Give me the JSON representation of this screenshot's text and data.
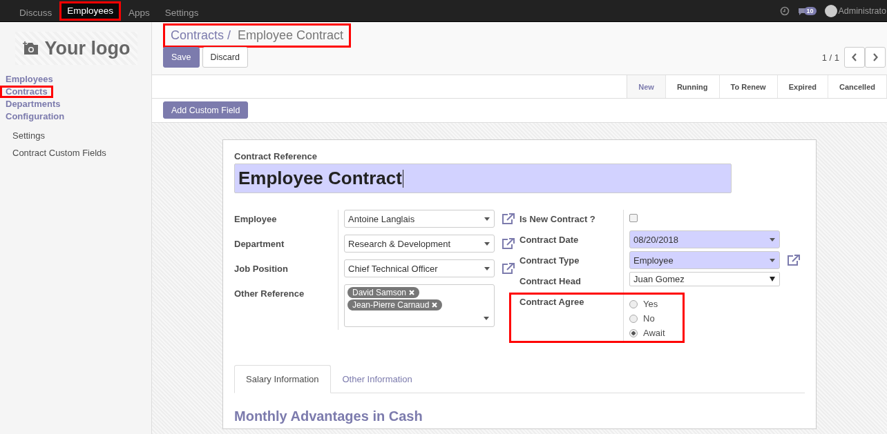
{
  "top_menu": [
    {
      "label": "Discuss",
      "selected": false,
      "highlighted": false
    },
    {
      "label": "Employees",
      "selected": true,
      "highlighted": true
    },
    {
      "label": "Apps",
      "selected": false,
      "highlighted": false
    },
    {
      "label": "Settings",
      "selected": false,
      "highlighted": false
    }
  ],
  "systray": {
    "message_count": "10",
    "user": "Administrato"
  },
  "sidebar": {
    "logo": "Your logo",
    "items": [
      {
        "label": "Employees",
        "highlighted": false,
        "kind": "section"
      },
      {
        "label": "Contracts",
        "highlighted": true,
        "kind": "section"
      },
      {
        "label": "Departments",
        "highlighted": false,
        "kind": "section"
      },
      {
        "label": "Configuration",
        "highlighted": false,
        "kind": "section"
      },
      {
        "label": "Settings",
        "highlighted": false,
        "kind": "sub"
      },
      {
        "label": "Contract Custom Fields",
        "highlighted": false,
        "kind": "sub"
      }
    ]
  },
  "breadcrumb": {
    "parent": "Contracts /",
    "current": "Employee Contract",
    "highlighted": true
  },
  "buttons": {
    "save": "Save",
    "discard": "Discard",
    "add_custom_field": "Add Custom Field"
  },
  "pager": {
    "value": "1 / 1"
  },
  "status_bar": [
    {
      "label": "New",
      "selected": true
    },
    {
      "label": "Running",
      "selected": false
    },
    {
      "label": "To Renew",
      "selected": false
    },
    {
      "label": "Expired",
      "selected": false
    },
    {
      "label": "Cancelled",
      "selected": false
    }
  ],
  "form": {
    "reference_label": "Contract Reference",
    "reference_value": "Employee Contract",
    "left_fields": [
      {
        "label": "Employee",
        "kind": "select",
        "value": "Antoine Langlais",
        "link": true
      },
      {
        "label": "Department",
        "kind": "select",
        "value": "Research & Development",
        "link": true
      },
      {
        "label": "Job Position",
        "kind": "select",
        "value": "Chief Technical Officer",
        "link": true
      },
      {
        "label": "Other Reference",
        "kind": "tags",
        "tags": [
          "David Samson",
          "Jean-Pierre Carnaud"
        ]
      }
    ],
    "right_fields": [
      {
        "label": "Is New Contract ?",
        "kind": "checkbox",
        "checked": false
      },
      {
        "label": "Contract Date",
        "kind": "select",
        "value": "08/20/2018",
        "required": true
      },
      {
        "label": "Contract Type",
        "kind": "select",
        "value": "Employee",
        "required": true,
        "link": true
      },
      {
        "label": "Contract Head",
        "kind": "native",
        "value": "Juan Gomez"
      },
      {
        "label": "Contract Agree",
        "kind": "radio",
        "highlighted": true,
        "options": [
          {
            "label": "Yes",
            "selected": false
          },
          {
            "label": "No",
            "selected": false
          },
          {
            "label": "Await",
            "selected": true
          }
        ]
      }
    ],
    "tabs": [
      {
        "label": "Salary Information",
        "selected": true
      },
      {
        "label": "Other Information",
        "selected": false
      }
    ],
    "section_title": "Monthly Advantages in Cash"
  }
}
